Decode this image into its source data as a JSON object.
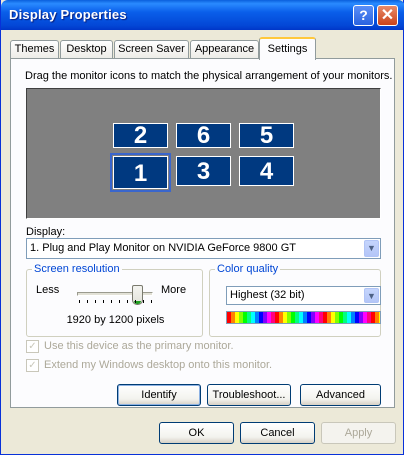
{
  "window": {
    "title": "Display Properties",
    "help_glyph": "?",
    "close_glyph": "✕"
  },
  "tabs": [
    {
      "label": "Themes"
    },
    {
      "label": "Desktop"
    },
    {
      "label": "Screen Saver"
    },
    {
      "label": "Appearance"
    },
    {
      "label": "Settings",
      "active": true
    }
  ],
  "settings": {
    "instruction": "Drag the monitor icons to match the physical arrangement of your monitors.",
    "monitors": [
      {
        "number": "2"
      },
      {
        "number": "6"
      },
      {
        "number": "5"
      },
      {
        "number": "1",
        "selected": true
      },
      {
        "number": "3"
      },
      {
        "number": "4"
      }
    ],
    "display_label": "Display:",
    "display_value": "1. Plug and Play Monitor on NVIDIA GeForce 9800 GT",
    "resolution": {
      "title": "Screen resolution",
      "less": "Less",
      "more": "More",
      "value_text": "1920 by 1200 pixels",
      "slider_level": 1.0
    },
    "color_quality": {
      "title": "Color quality",
      "value": "Highest (32 bit)"
    },
    "primary_checkbox": "Use this device as the primary monitor.",
    "extend_checkbox": "Extend my Windows desktop onto this monitor.",
    "identify_label": "Identify",
    "troubleshoot_label": "Troubleshoot...",
    "advanced_label": "Advanced"
  },
  "footer": {
    "ok": "OK",
    "cancel": "Cancel",
    "apply": "Apply"
  },
  "colors": {
    "title_bar": "#0A5FEA",
    "monitor_tile": "#003980",
    "monitor_area": "#808080",
    "selection": "#3A66CC"
  },
  "icons": {
    "dropdown": "chevron-down-icon",
    "check": "check-icon"
  }
}
